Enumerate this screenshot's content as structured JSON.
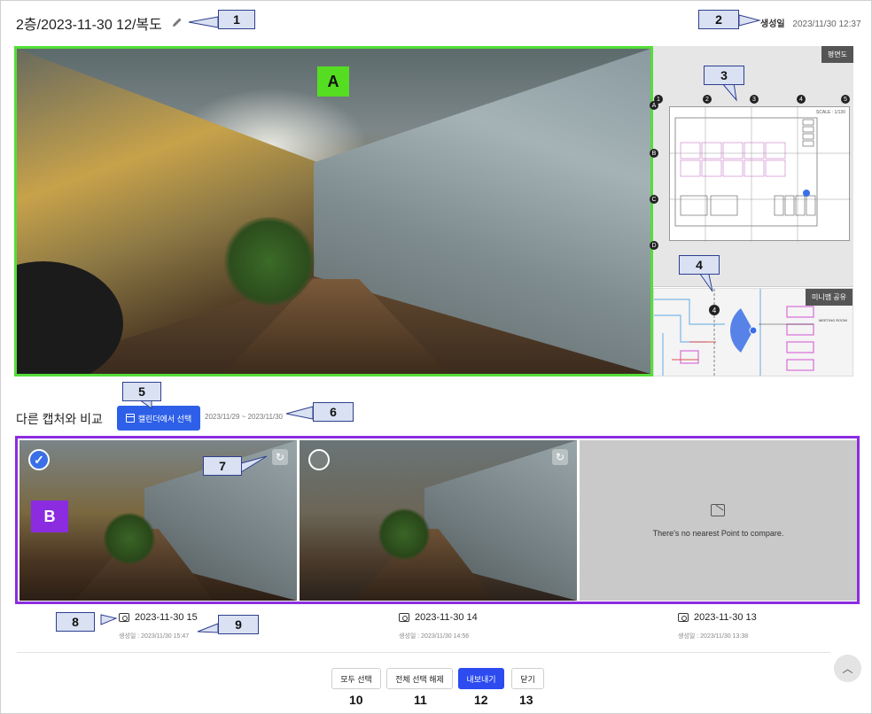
{
  "header": {
    "title": "2층/2023-11-30 12/복도",
    "created_label": "생성일",
    "created_value": "2023/11/30 12:37"
  },
  "plan": {
    "tag": "평면도",
    "scale": "SCALE : 1/130",
    "grid_numbers": [
      "1",
      "2",
      "3",
      "4",
      "5"
    ],
    "grid_letters": [
      "A",
      "B",
      "C",
      "D"
    ]
  },
  "minimap": {
    "tag": "미니맵 공유",
    "marker": "4",
    "room_label": "MEETING ROOM"
  },
  "compare": {
    "label": "다른 캡처와 비교",
    "calendar_button": "캘린더에서 선택",
    "range": "2023/11/29 ~ 2023/11/30",
    "empty_message": "There's no nearest Point to compare.",
    "items": [
      {
        "title": "2023-11-30 15",
        "sub": "생성일 : 2023/11/30 15:47",
        "selected": true
      },
      {
        "title": "2023-11-30 14",
        "sub": "생성일 : 2023/11/30 14:56",
        "selected": false
      },
      {
        "title": "2023-11-30 13",
        "sub": "생성일 : 2023/11/30 13:38",
        "selected": false
      }
    ]
  },
  "buttons": {
    "select_all": "모두 선택",
    "deselect_all": "전체 선택 해제",
    "export": "내보내기",
    "close": "닫기"
  },
  "annotations": {
    "callouts": [
      "1",
      "2",
      "3",
      "4",
      "5",
      "6",
      "7",
      "8",
      "9"
    ],
    "bottom_numbers": [
      "10",
      "11",
      "12",
      "13"
    ],
    "letters": [
      "A",
      "B"
    ]
  },
  "colors": {
    "accent_blue": "#2d4bef",
    "pano_border": "#55dd3a",
    "compare_border": "#8b2ce0",
    "callout_fill": "#d9e1f2"
  }
}
